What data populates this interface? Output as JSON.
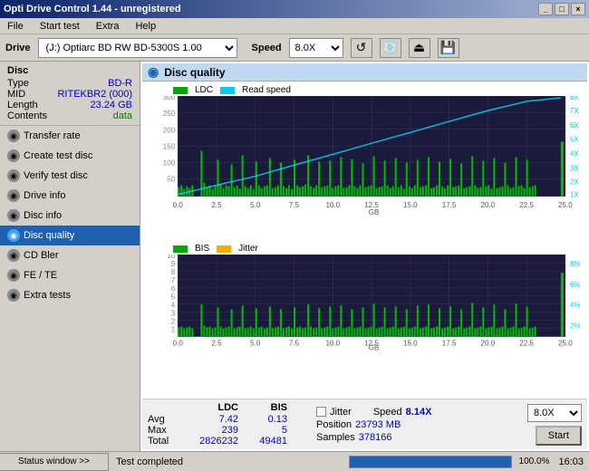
{
  "titleBar": {
    "title": "Opti Drive Control 1.44 - unregistered",
    "buttons": [
      "_",
      "□",
      "×"
    ]
  },
  "menuBar": {
    "items": [
      "File",
      "Start test",
      "Extra",
      "Help"
    ]
  },
  "driveBar": {
    "label": "Drive",
    "driveValue": "(J:)  Optiarc BD RW BD-5300S 1.00",
    "speedLabel": "Speed",
    "speedValue": "8.0X"
  },
  "disc": {
    "title": "Disc",
    "rows": [
      {
        "label": "Type",
        "value": "BD-R",
        "color": "blue"
      },
      {
        "label": "MID",
        "value": "RITEKBR2 (000)",
        "color": "blue"
      },
      {
        "label": "Length",
        "value": "23.24 GB",
        "color": "blue"
      },
      {
        "label": "Contents",
        "value": "data",
        "color": "green"
      }
    ]
  },
  "navItems": [
    {
      "label": "Transfer rate",
      "icon": "gray",
      "active": false
    },
    {
      "label": "Create test disc",
      "icon": "gray",
      "active": false
    },
    {
      "label": "Verify test disc",
      "icon": "gray",
      "active": false
    },
    {
      "label": "Drive info",
      "icon": "gray",
      "active": false
    },
    {
      "label": "Disc info",
      "icon": "gray",
      "active": false
    },
    {
      "label": "Disc quality",
      "icon": "blue",
      "active": true
    },
    {
      "label": "CD Bler",
      "icon": "gray",
      "active": false
    },
    {
      "label": "FE / TE",
      "icon": "gray",
      "active": false
    },
    {
      "label": "Extra tests",
      "icon": "gray",
      "active": false
    }
  ],
  "chartTitle": "Disc quality",
  "chart1": {
    "legend": [
      {
        "label": "LDC",
        "color": "#00aa00"
      },
      {
        "label": "Read speed",
        "color": "#00bbff"
      }
    ],
    "yAxisMax": 300,
    "yAxisLabels": [
      "300",
      "250",
      "200",
      "150",
      "100",
      "50"
    ],
    "xAxisMax": 25,
    "xAxisLabels": [
      "0.0",
      "2.5",
      "5.0",
      "7.5",
      "10.0",
      "12.5",
      "15.0",
      "17.5",
      "20.0",
      "22.5",
      "25.0"
    ],
    "yAxisRight": [
      "8X",
      "7X",
      "6X",
      "5X",
      "4X",
      "3X",
      "2X",
      "1X"
    ]
  },
  "chart2": {
    "legend": [
      {
        "label": "BIS",
        "color": "#00aa00"
      },
      {
        "label": "Jitter",
        "color": "#ffaa00"
      }
    ],
    "yAxisLabels": [
      "10",
      "9",
      "8",
      "7",
      "6",
      "5",
      "4",
      "3",
      "2",
      "1"
    ],
    "xAxisLabels": [
      "0.0",
      "2.5",
      "5.0",
      "7.5",
      "10.0",
      "12.5",
      "15.0",
      "17.5",
      "20.0",
      "22.5",
      "25.0"
    ],
    "yAxisRight": [
      "8%",
      "6%",
      "4%",
      "2%"
    ]
  },
  "stats": {
    "ldcLabel": "LDC",
    "bisLabel": "BIS",
    "rows": [
      {
        "label": "Avg",
        "ldc": "7.42",
        "bis": "0.13"
      },
      {
        "label": "Max",
        "ldc": "239",
        "bis": "5"
      },
      {
        "label": "Total",
        "ldc": "2826232",
        "bis": "49481"
      }
    ],
    "jitterLabel": "Jitter",
    "speedLabel": "Speed",
    "speedValue": "8.14X",
    "speedDropdown": "8.0X",
    "positionLabel": "Position",
    "positionValue": "23793 MB",
    "samplesLabel": "Samples",
    "samplesValue": "378166",
    "startBtn": "Start"
  },
  "statusBar": {
    "windowBtn": "Status window >>",
    "statusText": "Test completed",
    "progress": 100,
    "progressLabel": "100.0%",
    "time": "16:03"
  }
}
